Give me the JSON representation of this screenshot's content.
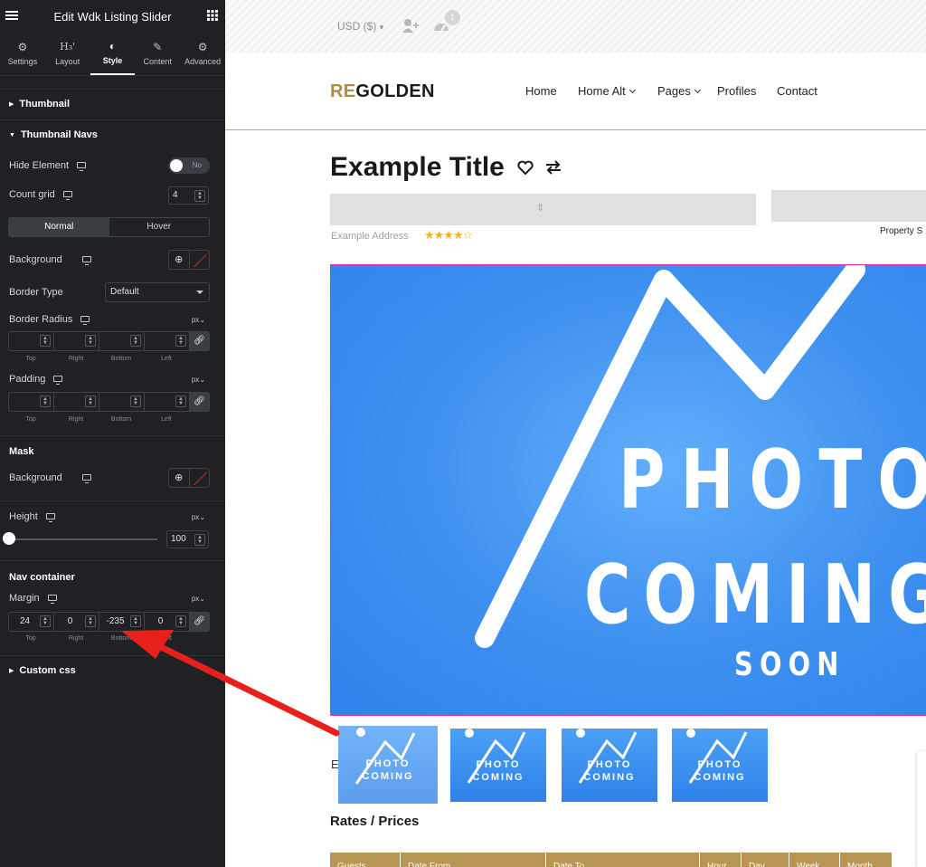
{
  "panel": {
    "title": "Edit Wdk Listing Slider",
    "tabs": [
      {
        "label": "Settings",
        "icon": "gears-icon"
      },
      {
        "label": "Layout",
        "icon": "heading-icon"
      },
      {
        "label": "Style",
        "icon": "contrast-icon"
      },
      {
        "label": "Content",
        "icon": "pencil-icon"
      },
      {
        "label": "Advanced",
        "icon": "gear-icon"
      }
    ],
    "heading_glyph": "H₃'",
    "sections": {
      "thumbnail": "Thumbnail",
      "thumbnail_navs": "Thumbnail Navs",
      "mask": "Mask",
      "nav_container": "Nav container",
      "custom_css": "Custom css"
    },
    "hide_element": {
      "label": "Hide Element",
      "value": "No"
    },
    "count_grid": {
      "label": "Count grid",
      "value": "4"
    },
    "state_tabs": {
      "normal": "Normal",
      "hover": "Hover"
    },
    "background_label": "Background",
    "border_type": {
      "label": "Border Type",
      "value": "Default"
    },
    "border_radius": {
      "label": "Border Radius",
      "unit": "px"
    },
    "padding": {
      "label": "Padding",
      "unit": "px"
    },
    "dim_labels": [
      "Top",
      "Right",
      "Bottom",
      "Left"
    ],
    "mask_background_label": "Background",
    "height": {
      "label": "Height",
      "unit": "px",
      "value": "100"
    },
    "margin": {
      "label": "Margin",
      "unit": "px",
      "values": [
        "24",
        "0",
        "-235",
        "0"
      ]
    }
  },
  "site": {
    "currency": "USD ($)",
    "notification_count": "1",
    "logo_accent": "RE",
    "logo_rest": "GOLDEN",
    "menu": [
      "Home",
      "Home Alt",
      "Pages",
      "Profiles",
      "Contact"
    ],
    "listing_title": "Example Title",
    "address": "Example Address",
    "rating": "★★★★☆",
    "property_label": "Property S",
    "photo_line1": "PHOTO",
    "photo_line2": "COMING",
    "photo_line3": "SOON",
    "cut_letter": "E",
    "rates_title": "Rates / Prices",
    "table_headers": [
      "Guests",
      "Date From",
      "Date To",
      "Hour",
      "Day",
      "Week",
      "Month"
    ]
  },
  "colors": {
    "accent_gold": "#b48a43",
    "annotation_arrow": "#e8201b",
    "photo_blue": "#3f91f0"
  }
}
